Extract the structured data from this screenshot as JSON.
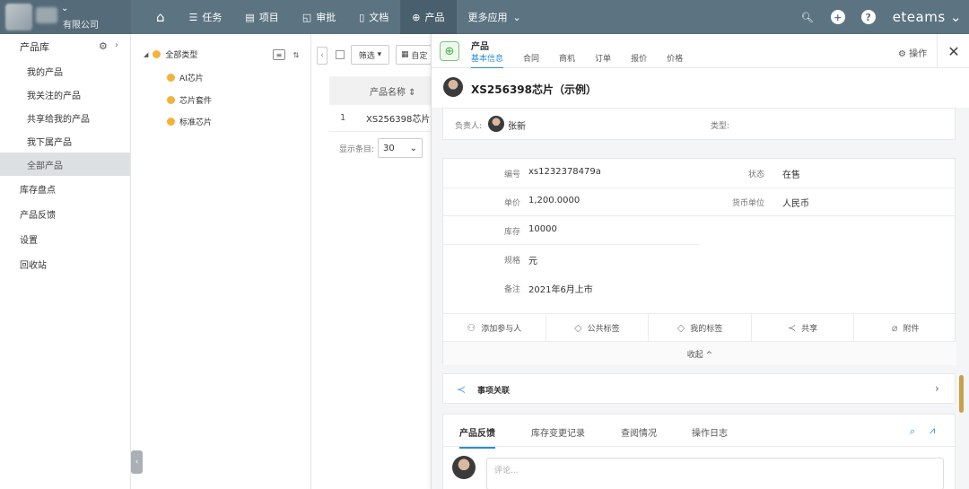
{
  "header": {
    "company": "有限公司",
    "nav": [
      {
        "icon": "home-icon",
        "label": ""
      },
      {
        "icon": "list-icon",
        "label": "任务"
      },
      {
        "icon": "project-icon",
        "label": "项目"
      },
      {
        "icon": "approval-icon",
        "label": "审批"
      },
      {
        "icon": "document-icon",
        "label": "文档"
      },
      {
        "icon": "globe-icon",
        "label": "产品"
      },
      {
        "icon": "",
        "label": "更多应用"
      }
    ],
    "brand": "eteams",
    "colors": {
      "topbar": "#5c7382",
      "accent": "#2b8cd8"
    }
  },
  "sidebar": {
    "title": "产品库",
    "sub_items": [
      "我的产品",
      "我关注的产品",
      "共享给我的产品",
      "我下属产品",
      "全部产品"
    ],
    "items": [
      "库存盘点",
      "产品反馈",
      "设置",
      "回收站"
    ]
  },
  "categories": {
    "root": "全部类型",
    "children": [
      "AI芯片",
      "芯片套件",
      "标准芯片"
    ]
  },
  "list": {
    "filter_label": "筛选",
    "custom_label": "自定",
    "column_header": "产品名称 ⇕",
    "rows": [
      {
        "index": "1",
        "name": "XS256398芯片"
      }
    ],
    "pager_label": "显示条目:",
    "page_size": "30"
  },
  "detail": {
    "module_title": "产品",
    "tabs": [
      "基本信息",
      "合同",
      "商机",
      "订单",
      "报价",
      "价格"
    ],
    "ops_label": "操作",
    "product_name": "XS256398芯片（示例）",
    "owner_label": "负责人:",
    "owner_name": "张新",
    "type_label": "类型:",
    "fields": {
      "code_label": "编号",
      "code": "xs1232378479a",
      "status_label": "状态",
      "status": "在售",
      "price_label": "单价",
      "price": "1,200.0000",
      "currency_label": "货币单位",
      "currency": "人民币",
      "stock_label": "库存",
      "stock": "10000",
      "spec_label": "规格",
      "spec": "元",
      "note_label": "备注",
      "note": "2021年6月上市"
    },
    "actions": [
      "添加参与人",
      "公共标签",
      "我的标签",
      "共享",
      "附件"
    ],
    "fold_label": "收起 ^",
    "relation_label": "事项关联",
    "bottom_tabs": [
      "产品反馈",
      "库存变更记录",
      "查阅情况",
      "操作日志"
    ],
    "comment_placeholder": "评论..."
  }
}
